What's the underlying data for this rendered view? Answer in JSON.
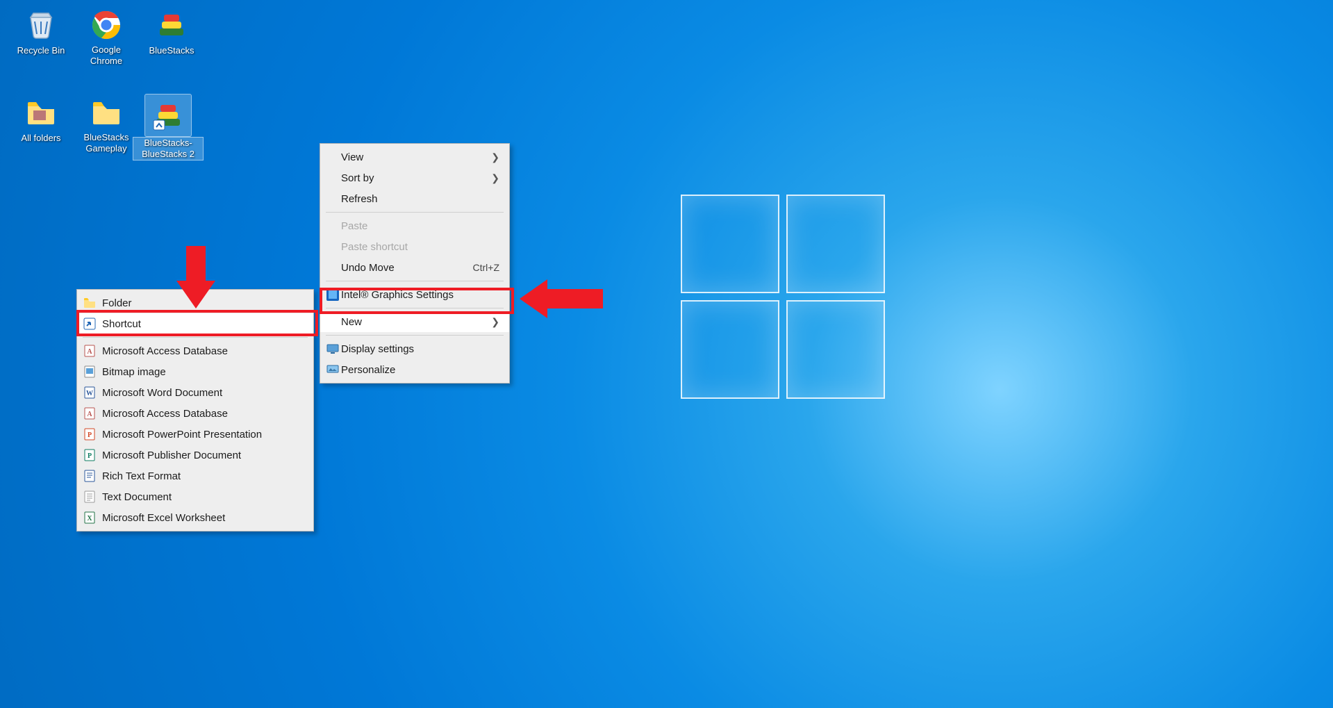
{
  "desktop": {
    "icons": [
      {
        "name": "recycle-bin",
        "label": "Recycle Bin"
      },
      {
        "name": "google-chrome",
        "label": "Google Chrome"
      },
      {
        "name": "bluestacks",
        "label": "BlueStacks"
      },
      {
        "name": "all-folders",
        "label": "All folders"
      },
      {
        "name": "bluestacks-gameplay",
        "label": "BlueStacks Gameplay"
      },
      {
        "name": "bluestacks-bluestacks2",
        "label": "BlueStacks-BlueStacks 2"
      }
    ]
  },
  "context_menu": {
    "view": "View",
    "sort_by": "Sort by",
    "refresh": "Refresh",
    "paste": "Paste",
    "paste_shortcut": "Paste shortcut",
    "undo_move": "Undo Move",
    "undo_move_accel": "Ctrl+Z",
    "intel_graphics": "Intel® Graphics Settings",
    "new": "New",
    "display_settings": "Display settings",
    "personalize": "Personalize"
  },
  "new_submenu": {
    "folder": "Folder",
    "shortcut": "Shortcut",
    "access_db": "Microsoft Access Database",
    "bitmap": "Bitmap image",
    "word": "Microsoft Word Document",
    "access_db2": "Microsoft Access Database",
    "powerpoint": "Microsoft PowerPoint Presentation",
    "publisher": "Microsoft Publisher Document",
    "rtf": "Rich Text Format",
    "text": "Text Document",
    "excel": "Microsoft Excel Worksheet"
  },
  "annotations": {
    "highlight_new": true,
    "highlight_shortcut": true
  }
}
